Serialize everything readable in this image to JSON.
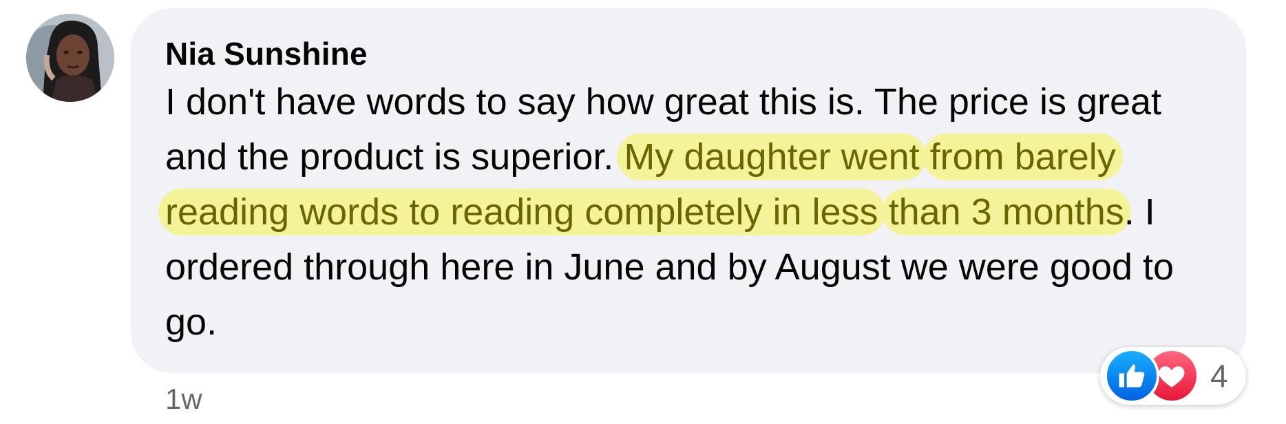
{
  "comment": {
    "author": "Nia Sunshine",
    "text_before": "I don't have words to say how great this is. The price is great and the product is superior.",
    "text_highlight_1": "My daughter went",
    "text_highlight_2": "from barely reading words to reading completely in less",
    "text_highlight_3": "than 3 months",
    "text_after": ". I ordered through here in June and by August we were good to go.",
    "timestamp": "1w",
    "reaction_count": "4",
    "reactions": [
      "like-icon",
      "love-icon"
    ]
  },
  "colors": {
    "bubble": "#f0f2f5",
    "highlight_bg": "#f5f39a",
    "highlight_text": "#6b6500",
    "like_blue": "#0866ff",
    "love_red": "#f33e58",
    "meta_gray": "#65676b"
  }
}
